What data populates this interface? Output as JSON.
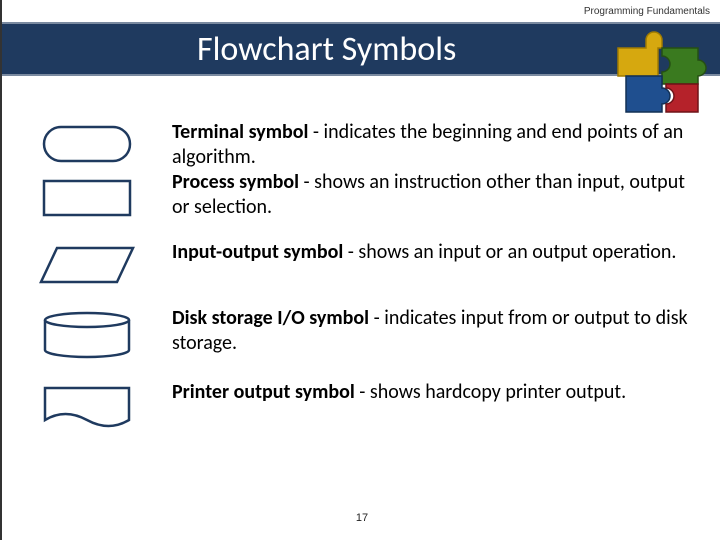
{
  "header": {
    "course": "Programming Fundamentals"
  },
  "title": "Flowchart Symbols",
  "symbols": [
    {
      "name_bold": "Terminal symbol",
      "desc": " - indicates the beginning and end points of an algorithm."
    },
    {
      "name_bold": "Process symbol",
      "desc": " - shows an instruction other than input, output or selection."
    },
    {
      "name_bold": "Input-output symbol",
      "desc": " - shows an input or an output operation."
    },
    {
      "name_bold": "Disk storage I/O symbol",
      "desc": " - indicates input from or output to disk storage."
    },
    {
      "name_bold": "Printer output symbol",
      "desc": " - shows hardcopy printer output."
    }
  ],
  "page_number": "17"
}
